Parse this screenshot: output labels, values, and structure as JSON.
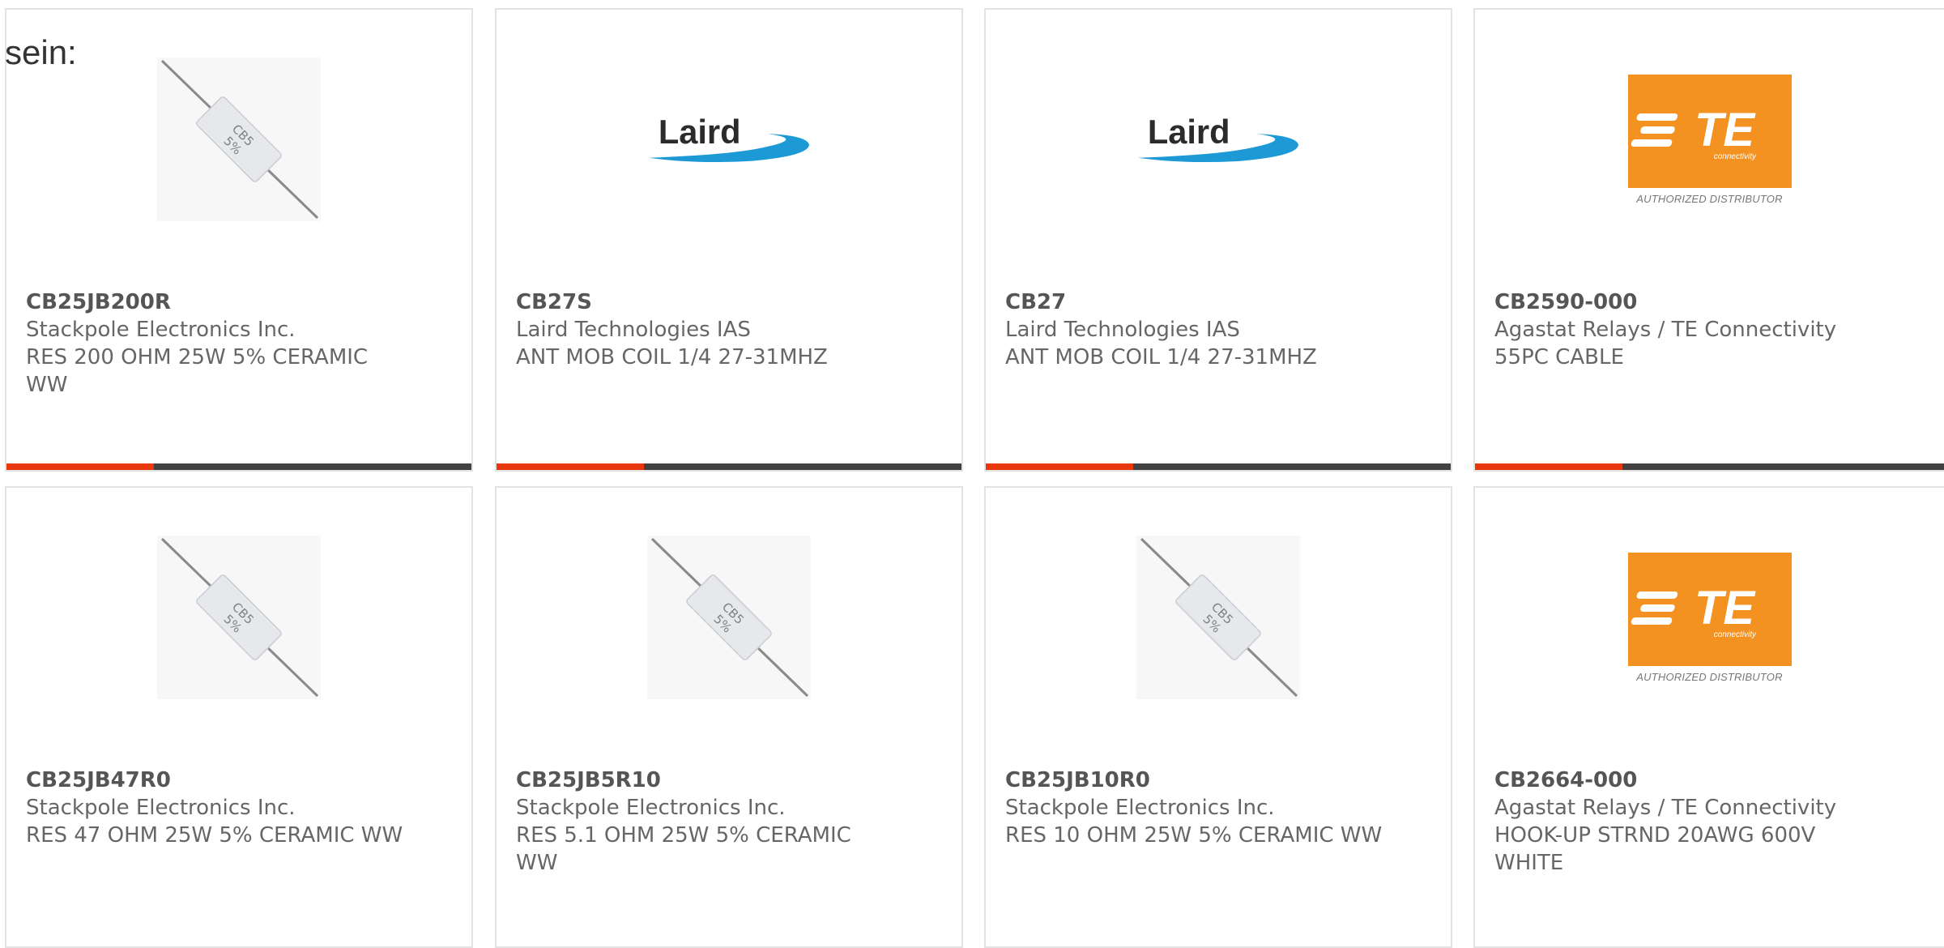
{
  "intro_text": "sein:",
  "colors": {
    "accent": "#e8380d",
    "bar": "#414141",
    "te_orange": "#f39220",
    "laird_blue": "#1d9ad6"
  },
  "products": [
    {
      "part_number": "CB25JB200R",
      "manufacturer": "Stackpole Electronics Inc.",
      "description": "RES 200 OHM 25W 5% CERAMIC WW",
      "image": "resistor",
      "image_text": "CB5 5%"
    },
    {
      "part_number": "CB27S",
      "manufacturer": "Laird Technologies IAS",
      "description": "ANT MOB COIL 1/4 27-31MHZ",
      "image": "laird-logo",
      "image_text": "Laird"
    },
    {
      "part_number": "CB27",
      "manufacturer": "Laird Technologies IAS",
      "description": "ANT MOB COIL 1/4 27-31MHZ",
      "image": "laird-logo",
      "image_text": "Laird"
    },
    {
      "part_number": "CB2590-000",
      "manufacturer": "Agastat Relays / TE Connectivity",
      "description": "55PC CABLE",
      "image": "te-logo",
      "image_text": "TE",
      "image_subtext": "connectivity",
      "image_caption": "AUTHORIZED DISTRIBUTOR"
    },
    {
      "part_number": "CB25JB47R0",
      "manufacturer": "Stackpole Electronics Inc.",
      "description": "RES 47 OHM 25W 5% CERAMIC WW",
      "image": "resistor",
      "image_text": "CB5 5%"
    },
    {
      "part_number": "CB25JB5R10",
      "manufacturer": "Stackpole Electronics Inc.",
      "description": "RES 5.1 OHM 25W 5% CERAMIC WW",
      "image": "resistor",
      "image_text": "CB5 5%"
    },
    {
      "part_number": "CB25JB10R0",
      "manufacturer": "Stackpole Electronics Inc.",
      "description": "RES 10 OHM 25W 5% CERAMIC WW",
      "image": "resistor",
      "image_text": "CB5 5%"
    },
    {
      "part_number": "CB2664-000",
      "manufacturer": "Agastat Relays / TE Connectivity",
      "description": "HOOK-UP STRND 20AWG 600V WHITE",
      "image": "te-logo",
      "image_text": "TE",
      "image_subtext": "connectivity",
      "image_caption": "AUTHORIZED DISTRIBUTOR"
    }
  ]
}
